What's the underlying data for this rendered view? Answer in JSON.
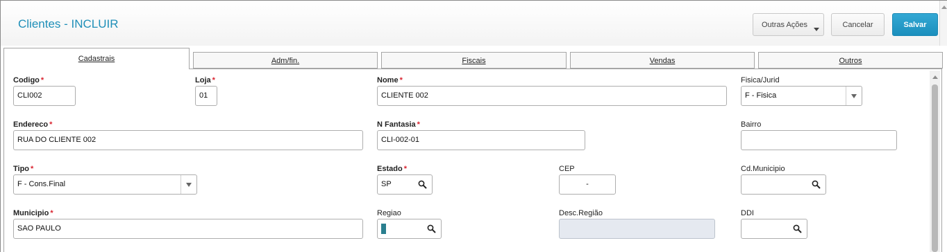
{
  "header": {
    "title": "Clientes - INCLUIR",
    "buttons": {
      "other_actions": "Outras Ações",
      "cancel": "Cancelar",
      "save": "Salvar"
    }
  },
  "tabs": [
    {
      "label": "Cadastrais",
      "active": true
    },
    {
      "label": "Adm/fin.",
      "active": false
    },
    {
      "label": "Fiscais",
      "active": false
    },
    {
      "label": "Vendas",
      "active": false
    },
    {
      "label": "Outros",
      "active": false
    }
  ],
  "fields": {
    "codigo": {
      "label": "Codigo",
      "required": "*",
      "value": "CLI002"
    },
    "loja": {
      "label": "Loja",
      "required": "*",
      "value": "01"
    },
    "nome": {
      "label": "Nome",
      "required": "*",
      "value": "CLIENTE 002"
    },
    "fisica_jurid": {
      "label": "Fisica/Jurid",
      "value": "F - Fisica"
    },
    "endereco": {
      "label": "Endereco",
      "required": "*",
      "value": "RUA DO CLIENTE 002"
    },
    "n_fantasia": {
      "label": "N Fantasia",
      "required": "*",
      "value": "CLI-002-01"
    },
    "bairro": {
      "label": "Bairro",
      "value": ""
    },
    "tipo": {
      "label": "Tipo",
      "required": "*",
      "value": "F - Cons.Final"
    },
    "estado": {
      "label": "Estado",
      "required": "*",
      "value": "SP"
    },
    "cep": {
      "label": "CEP",
      "value": "-"
    },
    "cd_municipio": {
      "label": "Cd.Municipio",
      "value": ""
    },
    "municipio": {
      "label": "Municipio",
      "required": "*",
      "value": "SAO PAULO"
    },
    "regiao": {
      "label": "Regiao",
      "value": ""
    },
    "desc_regiao": {
      "label": "Desc.Região",
      "value": ""
    },
    "ddi": {
      "label": "DDI",
      "value": ""
    }
  },
  "colors": {
    "title": "#1f8fb8",
    "save_button": "#1b8fbd",
    "required_star": "#d9232f",
    "disabled_field": "#e5e9f0"
  },
  "icons": {
    "lookup": "magnifier-icon",
    "dropdown": "chevron-down-icon"
  }
}
